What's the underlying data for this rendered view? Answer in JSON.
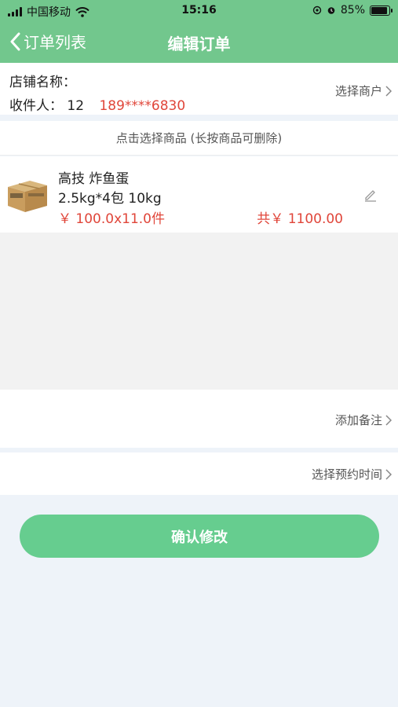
{
  "status_bar": {
    "carrier": "中国移动",
    "time": "15:16",
    "battery": "85%",
    "battery_level": 0.85
  },
  "nav": {
    "back_label": "订单列表",
    "title": "编辑订单"
  },
  "merchant": {
    "store_label": "店铺名称：",
    "receiver_label": "收件人：",
    "receiver_name": "12",
    "receiver_phone": "189****6830",
    "select_label": "选择商户"
  },
  "product_hint": "点击选择商品 (长按商品可删除)",
  "product": {
    "name": "高技 炸鱼蛋",
    "spec": "2.5kg*4包 10kg",
    "price": "￥ 100.0x11.0件",
    "total": "共￥ 1100.00"
  },
  "remark": {
    "label": "添加备注"
  },
  "schedule": {
    "label": "选择预约时间"
  },
  "confirm_label": "确认修改",
  "colors": {
    "header_green": "#72c78d",
    "button_green": "#66cd8f",
    "price_red": "#e0463a"
  }
}
